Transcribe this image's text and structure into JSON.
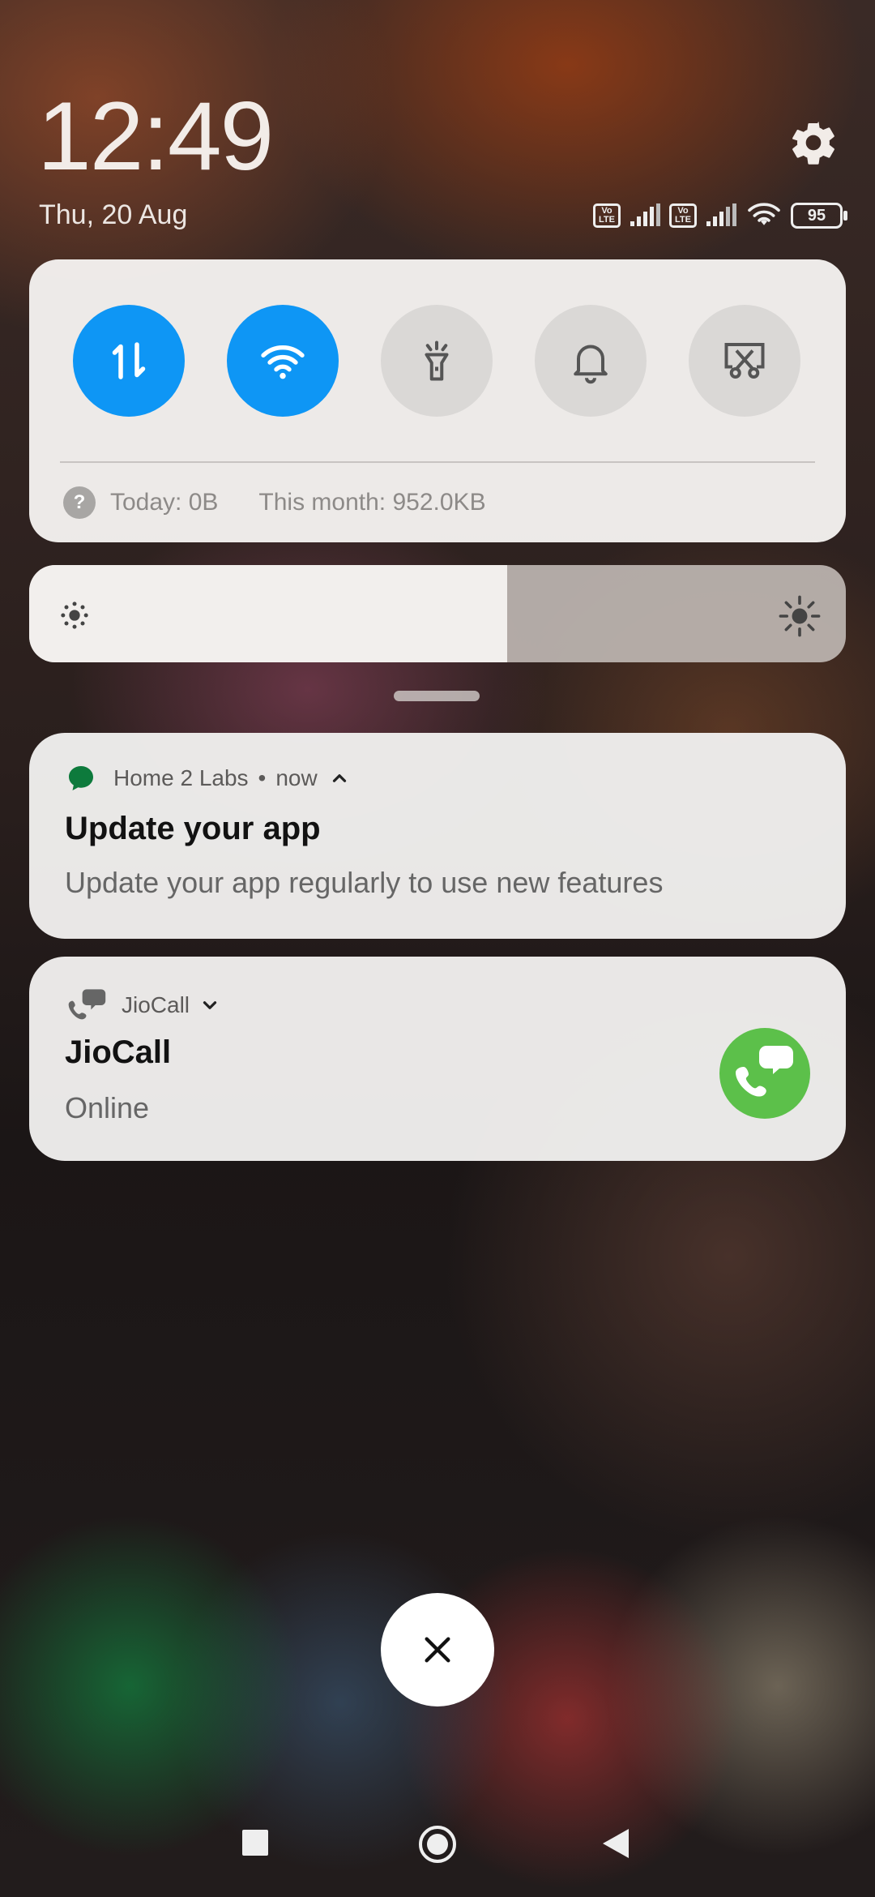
{
  "lockscreen": {
    "time": "12:49",
    "date": "Thu, 20 Aug"
  },
  "status_bar": {
    "sim1": "VoLTE",
    "sim2": "VoLTE",
    "volte_top": "Vo",
    "volte_bottom": "LTE",
    "battery": "95"
  },
  "quick_settings": {
    "tiles": [
      {
        "icon": "mobile-data-icon",
        "state": "on"
      },
      {
        "icon": "wifi-icon",
        "state": "on"
      },
      {
        "icon": "flashlight-icon",
        "state": "off"
      },
      {
        "icon": "bell-icon",
        "state": "off"
      },
      {
        "icon": "screenshot-icon",
        "state": "off"
      }
    ],
    "data_today": "Today: 0B",
    "data_month": "This month: 952.0KB",
    "info_glyph": "?"
  },
  "brightness": {
    "level": 0.585
  },
  "notifications": [
    {
      "app": "Home 2 Labs",
      "time": "now",
      "title": "Update your app",
      "body": "Update your app regularly to use new features"
    },
    {
      "app": "JioCall",
      "title": "JioCall",
      "body": "Online"
    }
  ],
  "colors": {
    "accent": "#0e96f5",
    "jiocall": "#5cc04a",
    "home2labs": "#0d7a3c"
  }
}
